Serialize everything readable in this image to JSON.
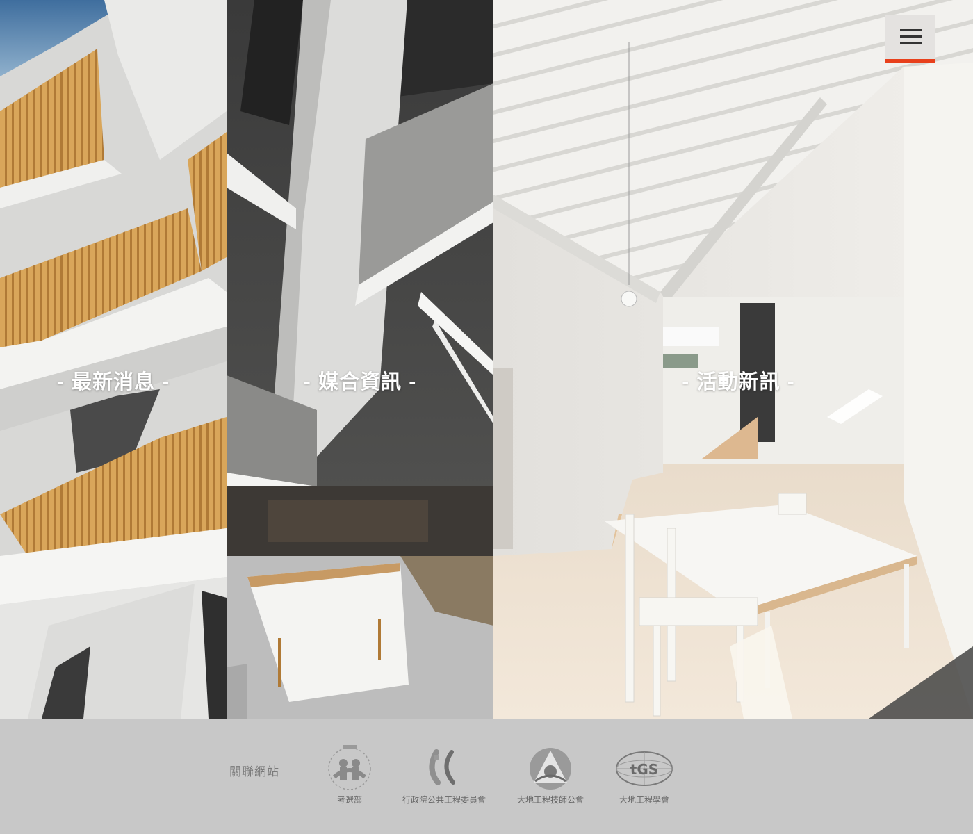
{
  "panels": [
    {
      "label": "最新消息",
      "image": "building-facade-wood-slats-photo"
    },
    {
      "label": "媒合資訊",
      "image": "atrium-interior-photo"
    },
    {
      "label": "活動新訊",
      "image": "white-dining-room-photo"
    }
  ],
  "menu": {
    "icon": "hamburger-icon",
    "accent_color": "#e8401c"
  },
  "footer": {
    "related_title": "關聯網站",
    "links": [
      {
        "caption": "考選部",
        "logo": "exam-ministry-logo"
      },
      {
        "caption": "行政院公共工程委員會",
        "logo": "pcc-logo"
      },
      {
        "caption": "大地工程技師公會",
        "logo": "geotech-engineers-association-logo"
      },
      {
        "caption": "大地工程學會",
        "logo": "tgs-logo"
      }
    ]
  }
}
